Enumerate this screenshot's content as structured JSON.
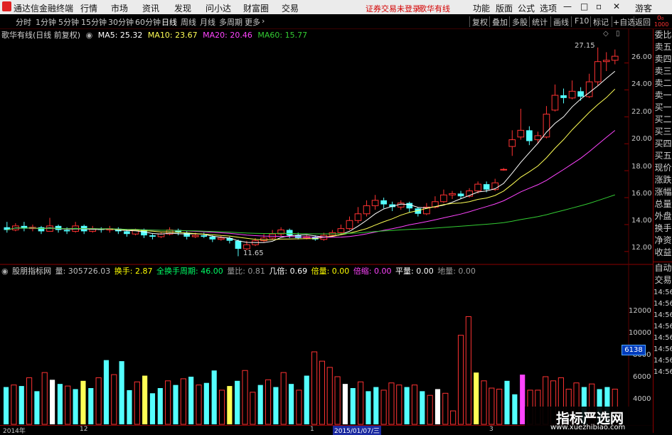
{
  "menubar": {
    "app_title": "通达信金融终端",
    "items": [
      "行情",
      "市场",
      "资讯",
      "发现",
      "问小达",
      "财富圈",
      "交易"
    ],
    "status": "证券交易未登录",
    "stock": "歌华有线",
    "right_items": [
      "功能",
      "版面",
      "公式",
      "选项"
    ],
    "user": "游客"
  },
  "tabbar": {
    "periods": [
      "分时",
      "1分钟",
      "5分钟",
      "15分钟",
      "30分钟",
      "60分钟",
      "日线",
      "周线",
      "月线",
      "多周期",
      "更多"
    ],
    "active_period": "日线",
    "tools": [
      "复权",
      "叠加",
      "多股",
      "统计",
      "画线",
      "F10",
      "标记",
      "+自选",
      "返回"
    ]
  },
  "main_chart": {
    "title": "歌华有线(日线 前复权)",
    "ma": [
      {
        "label": "MA5: 25.32",
        "color": "#ffffff"
      },
      {
        "label": "MA10: 23.67",
        "color": "#ffff55"
      },
      {
        "label": "MA20: 20.46",
        "color": "#ff44ff"
      },
      {
        "label": "MA60: 15.77",
        "color": "#33cc33"
      }
    ],
    "y_labels": [
      "26.00",
      "24.00",
      "22.00",
      "20.00",
      "18.00",
      "16.00",
      "14.00",
      "12.00"
    ],
    "high_label": "27.15",
    "low_label": "11.65"
  },
  "right_panel": {
    "labels": [
      "委比",
      "卖五",
      "卖四",
      "卖三",
      "卖二",
      "卖一",
      "买一",
      "买二",
      "买三",
      "买四",
      "买五",
      "现价",
      "涨跌",
      "涨幅",
      "总量",
      "外盘",
      "换手",
      "净资",
      "收益",
      "自动",
      "交易"
    ],
    "times": [
      "14:56",
      "14:56",
      "14:56",
      "14:56",
      "14:56",
      "14:56",
      "14:56",
      "14:56"
    ],
    "corner_top": "0₀",
    "corner_num": "1000"
  },
  "volume_chart": {
    "title": "股朋指标网",
    "items": [
      {
        "label": "量: 305726.03",
        "color": "#c0c0c0"
      },
      {
        "label": "换手: 2.87",
        "color": "#ffff00"
      },
      {
        "label": "全换手周期: 46.00",
        "color": "#00ff66"
      },
      {
        "label": "量比: 0.81",
        "color": "#9a9a9a"
      },
      {
        "label": "几倍: 0.69",
        "color": "#ffffff"
      },
      {
        "label": "倍量: 0.00",
        "color": "#ffff00"
      },
      {
        "label": "倍缩: 0.00",
        "color": "#ff44ff"
      },
      {
        "label": "平量: 0.00",
        "color": "#ffffff"
      },
      {
        "label": "地量: 0.00",
        "color": "#9a9a9a"
      }
    ],
    "y_labels": [
      "12000",
      "10000",
      "8000",
      "6000",
      "4000"
    ],
    "current_value": "6138"
  },
  "x_axis": {
    "labels": [
      "2014年",
      "12",
      "1",
      "2015/01/07/三",
      "3"
    ]
  },
  "watermark": {
    "title": "指标严选网",
    "url": "www.xuezhibiao.com"
  },
  "chart_data": {
    "type": "candlestick",
    "ylim": [
      11.2,
      28.3
    ],
    "vol_ylim": [
      0,
      14000
    ],
    "candles": [
      [
        13.8,
        13.6,
        14.2,
        13.4,
        1
      ],
      [
        13.6,
        13.9,
        14.1,
        13.5,
        0
      ],
      [
        13.9,
        13.7,
        14.2,
        13.5,
        1
      ],
      [
        13.7,
        13.8,
        14.0,
        13.5,
        0
      ],
      [
        13.8,
        13.5,
        13.9,
        13.3,
        1
      ],
      [
        13.5,
        13.9,
        14.5,
        13.5,
        0
      ],
      [
        13.9,
        13.6,
        14.0,
        13.4,
        1
      ],
      [
        13.6,
        13.5,
        13.8,
        13.3,
        1
      ],
      [
        13.5,
        13.9,
        14.2,
        13.4,
        0
      ],
      [
        13.9,
        13.5,
        14.0,
        13.3,
        1
      ],
      [
        13.5,
        13.7,
        13.9,
        13.4,
        0
      ],
      [
        13.7,
        13.6,
        13.8,
        13.4,
        1
      ],
      [
        13.6,
        13.7,
        13.9,
        13.4,
        0
      ],
      [
        13.7,
        13.5,
        13.8,
        13.3,
        1
      ],
      [
        13.5,
        13.3,
        13.6,
        13.1,
        1
      ],
      [
        13.3,
        13.6,
        13.7,
        13.2,
        0
      ],
      [
        13.6,
        13.2,
        13.7,
        13.0,
        1
      ],
      [
        13.2,
        13.1,
        13.3,
        12.9,
        1
      ],
      [
        13.1,
        13.3,
        13.4,
        13.0,
        0
      ],
      [
        13.3,
        13.6,
        13.8,
        13.2,
        0
      ],
      [
        13.6,
        13.4,
        13.7,
        13.2,
        1
      ],
      [
        13.4,
        13.1,
        13.5,
        12.9,
        1
      ],
      [
        13.1,
        13.2,
        13.4,
        13.0,
        0
      ],
      [
        13.2,
        13.1,
        13.4,
        13.0,
        1
      ],
      [
        13.1,
        12.9,
        13.2,
        12.7,
        1
      ],
      [
        12.9,
        13.0,
        13.2,
        12.8,
        0
      ],
      [
        13.0,
        12.8,
        13.1,
        12.6,
        1
      ],
      [
        12.8,
        12.2,
        12.9,
        11.65,
        1
      ],
      [
        12.2,
        12.5,
        12.8,
        12.1,
        0
      ],
      [
        12.5,
        12.8,
        13.0,
        12.4,
        0
      ],
      [
        12.8,
        13.0,
        13.3,
        12.7,
        0
      ],
      [
        13.0,
        13.3,
        13.6,
        12.9,
        0
      ],
      [
        13.3,
        13.6,
        13.8,
        13.1,
        0
      ],
      [
        13.6,
        13.2,
        13.7,
        13.0,
        1
      ],
      [
        13.2,
        13.0,
        13.4,
        12.9,
        1
      ],
      [
        13.0,
        13.1,
        13.2,
        12.9,
        0
      ],
      [
        13.1,
        12.9,
        13.2,
        12.8,
        1
      ],
      [
        12.9,
        13.2,
        13.4,
        12.8,
        0
      ],
      [
        13.2,
        13.4,
        13.6,
        13.1,
        0
      ],
      [
        13.4,
        13.7,
        14.0,
        13.3,
        0
      ],
      [
        13.7,
        14.3,
        14.6,
        13.6,
        0
      ],
      [
        14.3,
        14.8,
        15.3,
        14.1,
        0
      ],
      [
        14.8,
        15.4,
        15.8,
        14.6,
        0
      ],
      [
        15.4,
        15.8,
        16.2,
        15.1,
        0
      ],
      [
        15.8,
        15.5,
        16.0,
        15.2,
        1
      ],
      [
        15.5,
        15.3,
        15.7,
        15.0,
        1
      ],
      [
        15.3,
        15.6,
        15.8,
        15.1,
        0
      ],
      [
        15.6,
        15.2,
        15.7,
        14.9,
        1
      ],
      [
        15.2,
        14.8,
        15.3,
        14.6,
        1
      ],
      [
        14.8,
        15.3,
        15.6,
        14.7,
        0
      ],
      [
        15.3,
        15.7,
        16.1,
        15.2,
        0
      ],
      [
        15.7,
        16.2,
        16.6,
        15.6,
        0
      ],
      [
        16.2,
        16.3,
        16.5,
        15.9,
        0
      ],
      [
        16.3,
        16.1,
        16.5,
        15.9,
        1
      ],
      [
        16.1,
        16.5,
        16.7,
        16.0,
        0
      ],
      [
        16.5,
        17.0,
        17.2,
        16.3,
        0
      ],
      [
        17.0,
        16.6,
        17.2,
        16.4,
        1
      ],
      [
        16.6,
        17.1,
        17.4,
        16.5,
        0
      ],
      [
        18.1,
        18.1,
        18.2,
        18.0,
        0
      ],
      [
        19.8,
        20.3,
        21.0,
        19.1,
        0
      ],
      [
        20.5,
        21.0,
        22.6,
        20.3,
        0
      ],
      [
        21.0,
        20.2,
        21.3,
        19.9,
        1
      ],
      [
        20.3,
        20.6,
        20.9,
        20.0,
        0
      ],
      [
        20.5,
        22.2,
        22.8,
        20.4,
        0
      ],
      [
        22.5,
        23.6,
        24.4,
        22.4,
        0
      ],
      [
        23.6,
        23.4,
        24.1,
        23.0,
        1
      ],
      [
        23.4,
        23.9,
        24.7,
        23.3,
        0
      ],
      [
        23.9,
        23.5,
        24.2,
        23.2,
        1
      ],
      [
        23.5,
        24.6,
        25.2,
        23.4,
        0
      ],
      [
        24.6,
        26.1,
        27.15,
        24.3,
        0
      ],
      [
        26.1,
        26.2,
        26.8,
        25.4,
        0
      ],
      [
        26.2,
        26.5,
        27.0,
        25.9,
        0
      ]
    ],
    "volumes": [
      [
        3600,
        1
      ],
      [
        3800,
        0
      ],
      [
        3700,
        1
      ],
      [
        4500,
        0
      ],
      [
        3200,
        1
      ],
      [
        5000,
        0
      ],
      [
        4300,
        1
      ],
      [
        3900,
        1
      ],
      [
        3700,
        0
      ],
      [
        3400,
        1
      ],
      [
        4200,
        0
      ],
      [
        3500,
        1
      ],
      [
        4500,
        0
      ],
      [
        6200,
        1
      ],
      [
        4800,
        0
      ],
      [
        6100,
        1
      ],
      [
        3300,
        1
      ],
      [
        4100,
        0
      ],
      [
        4700,
        1
      ],
      [
        3000,
        1
      ],
      [
        3500,
        1
      ],
      [
        4200,
        0
      ],
      [
        3800,
        1
      ],
      [
        4400,
        0
      ],
      [
        4600,
        1
      ],
      [
        3800,
        0
      ],
      [
        4000,
        1
      ],
      [
        5200,
        1
      ],
      [
        3300,
        0
      ],
      [
        3700,
        0
      ],
      [
        4200,
        1
      ],
      [
        5200,
        0
      ],
      [
        3100,
        0
      ],
      [
        3800,
        1
      ],
      [
        4300,
        0
      ],
      [
        3600,
        1
      ],
      [
        5000,
        0
      ],
      [
        3900,
        1
      ],
      [
        3300,
        0
      ],
      [
        4700,
        1
      ],
      [
        7000,
        0
      ],
      [
        6100,
        0
      ],
      [
        5500,
        0
      ],
      [
        4600,
        0
      ],
      [
        3900,
        1
      ],
      [
        3500,
        1
      ],
      [
        4100,
        0
      ],
      [
        3200,
        1
      ],
      [
        3600,
        1
      ],
      [
        3300,
        0
      ],
      [
        4000,
        0
      ],
      [
        3800,
        0
      ],
      [
        3600,
        1
      ],
      [
        3800,
        0
      ],
      [
        3200,
        1
      ],
      [
        2800,
        0
      ],
      [
        3400,
        1
      ],
      [
        3000,
        0
      ],
      [
        1300,
        0
      ],
      [
        8600,
        0
      ],
      [
        10400,
        0
      ],
      [
        5000,
        1
      ],
      [
        4200,
        0
      ],
      [
        3500,
        0
      ],
      [
        3400,
        0
      ],
      [
        4200,
        1
      ],
      [
        2900,
        1
      ],
      [
        4800,
        0
      ],
      [
        3300,
        0
      ],
      [
        3300,
        0
      ],
      [
        4600,
        0
      ],
      [
        4200,
        0
      ],
      [
        4500,
        0
      ],
      [
        3400,
        0
      ],
      [
        4000,
        0
      ],
      [
        3600,
        1
      ],
      [
        3900,
        0
      ],
      [
        3400,
        1
      ],
      [
        3600,
        1
      ],
      [
        3400,
        0
      ]
    ],
    "vol_highlight": {
      "6": "#ffffff",
      "10": "#ffff55",
      "18": "#ffff55",
      "29": "#ffff55",
      "44": "#ffffff",
      "56": "#ffffff",
      "61": "#ffff55",
      "67": "#ff44ff"
    }
  }
}
